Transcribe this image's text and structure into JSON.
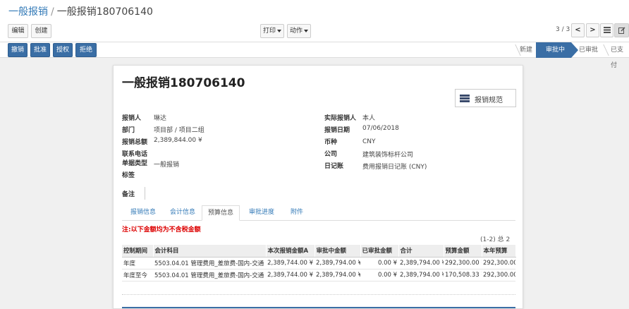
{
  "breadcrumb": {
    "parent": "一般报销",
    "current": "一般报销180706140"
  },
  "toolbar": {
    "edit": "编辑",
    "create": "创建",
    "print": "打印",
    "action": "动作"
  },
  "pager": {
    "value": "3 / 3",
    "prev": "<",
    "next": ">"
  },
  "actions": {
    "withdraw": "撤销",
    "approve": "批准",
    "authorize": "授权",
    "reject": "拒绝"
  },
  "stages": {
    "new": "新建",
    "approving": "审批中",
    "approved": "已审批",
    "paid": "已支付"
  },
  "form": {
    "title": "一般报销180706140",
    "smart_button": "报销规范",
    "left": [
      {
        "label": "报销人",
        "value": "琳达"
      },
      {
        "label": "部门",
        "value": "项目部 / 项目二组"
      },
      {
        "label": "报销总额",
        "value": "2,389,844.00 ¥"
      },
      {
        "label": "联系电话",
        "value": ""
      },
      {
        "label": "单据类型",
        "value": "一般报销"
      },
      {
        "label": "标签",
        "value": ""
      }
    ],
    "right": [
      {
        "label": "实际报销人",
        "value": "本人"
      },
      {
        "label": "报销日期",
        "value": "07/06/2018"
      },
      {
        "label": "币种",
        "value": "CNY"
      },
      {
        "label": "公司",
        "value": "建筑装饰标杆公司"
      },
      {
        "label": "日记账",
        "value": "费用报销日记账 (CNY)"
      }
    ],
    "remark_label": "备注"
  },
  "tabs": [
    "报销信息",
    "会计信息",
    "预算信息",
    "审批进度",
    "附件"
  ],
  "notice": "注:以下金额均为不含税金额",
  "count": "(1-2) 总 2",
  "table": {
    "headers": [
      "控制期间",
      "会计科目",
      "本次报销金额A",
      "审批中金额",
      "已审批金额",
      "合计",
      "预算金额",
      "本年预算"
    ],
    "rows": [
      [
        "年度",
        "5503.04.01 管理费用_差旅费-国内-交通",
        "2,389,744.00 ¥",
        "2,389,794.00 ¥",
        "0.00 ¥",
        "2,389,794.00 ¥",
        "292,300.00 ¥",
        "292,300.00"
      ],
      [
        "年度至今",
        "5503.04.01 管理费用_差旅费-国内-交通",
        "2,389,744.00 ¥",
        "2,389,794.00 ¥",
        "0.00 ¥",
        "2,389,794.00 ¥",
        "170,508.33 ¥",
        "292,300.00"
      ]
    ]
  },
  "colors": {
    "primary": "#3a6ea5",
    "link": "#337ab7",
    "notice": "#dd0000"
  }
}
